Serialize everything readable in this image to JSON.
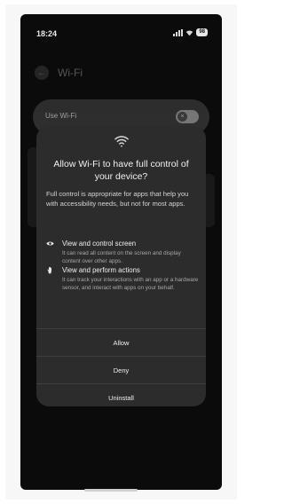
{
  "status_bar": {
    "time": "18:24",
    "battery": "98"
  },
  "background": {
    "title": "Wi-Fi",
    "use_wifi_label": "Use Wi-Fi"
  },
  "dialog": {
    "title": "Allow Wi-Fi to have full control of your device?",
    "description": "Full control is appropriate for apps that help you with accessibility needs, but not for most apps.",
    "permissions": [
      {
        "icon": "eye-icon",
        "title": "View and control screen",
        "description": "It can read all content on the screen and display content over other apps."
      },
      {
        "icon": "hand-icon",
        "title": "View and perform actions",
        "description": "It can track your interactions with an app or a hardware sensor, and interact with apps on your behalf."
      }
    ],
    "buttons": {
      "allow": "Allow",
      "deny": "Deny",
      "uninstall": "Uninstall"
    }
  },
  "colors": {
    "screen_bg": "#0b0b0b",
    "dialog_bg": "#2c2c2c",
    "text_primary": "#f1f1f1",
    "text_secondary": "#a8a8a8"
  }
}
